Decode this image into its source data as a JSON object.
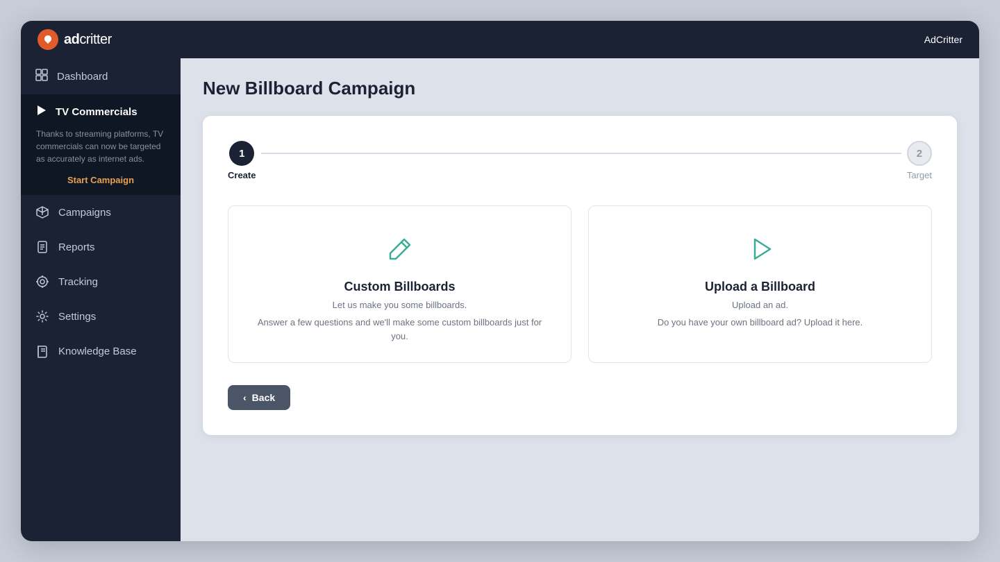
{
  "topbar": {
    "logo_text_ad": "ad",
    "logo_text_critter": "critter",
    "app_name": "AdCritter"
  },
  "sidebar": {
    "items": [
      {
        "id": "dashboard",
        "label": "Dashboard",
        "icon": "grid-icon"
      },
      {
        "id": "tv-commercials",
        "label": "TV Commercials",
        "icon": "play-icon",
        "active": true
      },
      {
        "id": "campaigns",
        "label": "Campaigns",
        "icon": "box-icon"
      },
      {
        "id": "reports",
        "label": "Reports",
        "icon": "document-icon"
      },
      {
        "id": "tracking",
        "label": "Tracking",
        "icon": "tracking-icon"
      },
      {
        "id": "settings",
        "label": "Settings",
        "icon": "settings-icon"
      },
      {
        "id": "knowledge-base",
        "label": "Knowledge Base",
        "icon": "book-icon"
      }
    ],
    "tv_commercials": {
      "description": "Thanks to streaming platforms, TV commercials can now be targeted as accurately as internet ads.",
      "cta": "Start Campaign"
    }
  },
  "page": {
    "title": "New Billboard Campaign",
    "stepper": {
      "steps": [
        {
          "number": "1",
          "label": "Create",
          "active": true
        },
        {
          "number": "2",
          "label": "Target",
          "active": false
        }
      ]
    },
    "options": [
      {
        "id": "custom-billboards",
        "icon": "pencil-icon",
        "title": "Custom Billboards",
        "subtitle": "Let us make you some billboards.",
        "description": "Answer a few questions and we'll make some custom billboards just for you."
      },
      {
        "id": "upload-billboard",
        "icon": "play-outline-icon",
        "title": "Upload a Billboard",
        "subtitle": "Upload an ad.",
        "description": "Do you have your own billboard ad? Upload it here."
      }
    ],
    "back_button": "Back"
  }
}
